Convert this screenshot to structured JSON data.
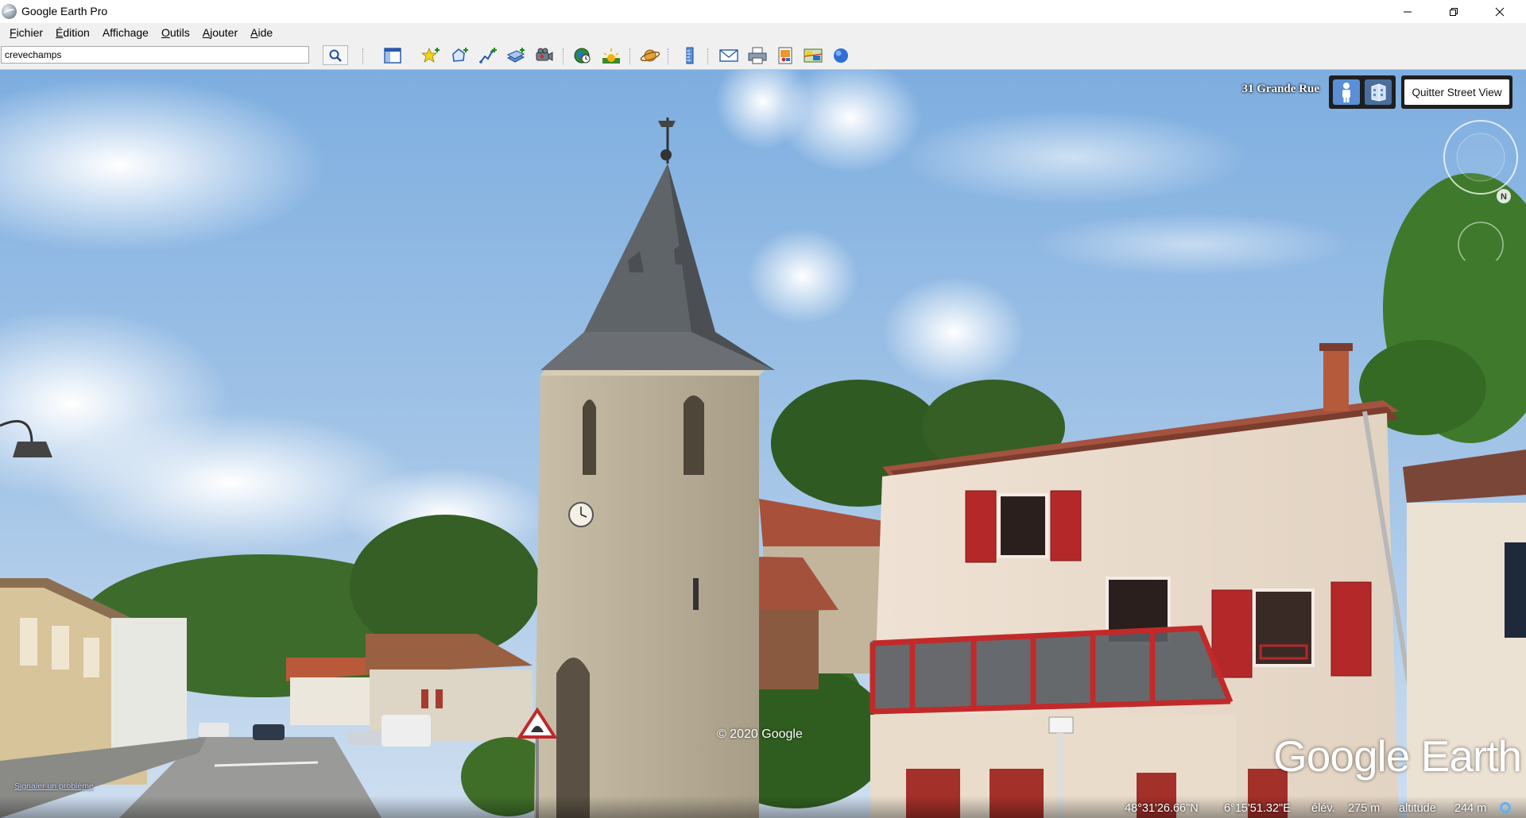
{
  "window": {
    "title": "Google Earth Pro"
  },
  "menu": {
    "items": [
      {
        "accel": "F",
        "rest": "ichier"
      },
      {
        "accel": "É",
        "rest": "dition"
      },
      {
        "accel": "",
        "rest": "Affichage"
      },
      {
        "accel": "O",
        "rest": "utils"
      },
      {
        "accel": "A",
        "rest": "jouter"
      },
      {
        "accel": "A",
        "rest": "ide"
      }
    ]
  },
  "toolbar": {
    "search_value": "crevechamps",
    "buttons": [
      "sidebar-toggle",
      "placemark-add",
      "polygon-add",
      "path-add",
      "image-overlay-add",
      "tour-record",
      "historical-imagery",
      "sunlight",
      "planets",
      "ruler",
      "email",
      "print",
      "save-image",
      "view-in-maps",
      "sign-in"
    ]
  },
  "streetview": {
    "address": "31 Grande Rue",
    "quit_label": "Quitter Street View",
    "copyright": "© 2020 Google",
    "report_problem": "Signaler un problème",
    "brand": "Google Earth",
    "compass_north": "N"
  },
  "status": {
    "latitude": "48°31'26.66\"N",
    "longitude": "6°15'51.32\"E",
    "elevation_label": "élév.",
    "elevation": "275 m",
    "altitude_label": "altitude",
    "altitude": "244 m"
  },
  "colors": {
    "sky": "#8fb5dc",
    "shutter_red": "#b4282a",
    "status_ring": "#5ab4ff",
    "mode_active": "#5a8fd6"
  }
}
